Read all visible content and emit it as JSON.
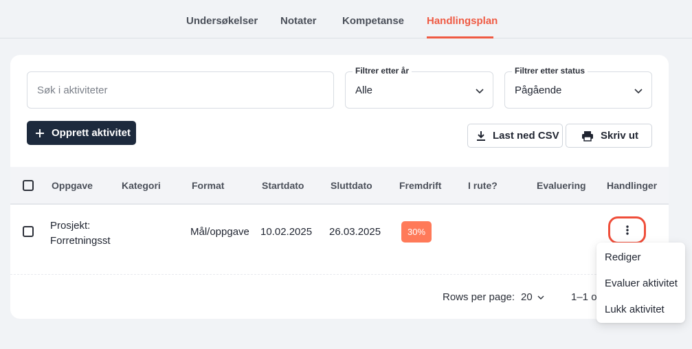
{
  "tabs": [
    {
      "label": "Undersøkelser",
      "active": false
    },
    {
      "label": "Notater",
      "active": false
    },
    {
      "label": "Kompetanse",
      "active": false
    },
    {
      "label": "Handlingsplan",
      "active": true
    }
  ],
  "search": {
    "placeholder": "Søk i aktiviteter",
    "value": ""
  },
  "filters": {
    "year": {
      "label": "Filtrer etter år",
      "value": "Alle"
    },
    "status": {
      "label": "Filtrer etter status",
      "value": "Pågående"
    }
  },
  "buttons": {
    "create": "Opprett aktivitet",
    "download_csv": "Last ned CSV",
    "print": "Skriv ut"
  },
  "table": {
    "columns": [
      "Oppgave",
      "Kategori",
      "Format",
      "Startdato",
      "Sluttdato",
      "Fremdrift",
      "I rute?",
      "Evaluering",
      "Handlinger"
    ],
    "rows": [
      {
        "task_line1": "Prosjekt:",
        "task_line2": "Forretningsst",
        "category": "",
        "format": "Mål/oppgave",
        "start": "10.02.2025",
        "end": "26.03.2025",
        "progress": "30%",
        "on_track": "",
        "evaluation": ""
      }
    ]
  },
  "pagination": {
    "rows_per_page_label": "Rows per page:",
    "rows_per_page": "20",
    "range": "1–1 of"
  },
  "menu": {
    "items": [
      "Rediger",
      "Evaluer aktivitet",
      "Lukk aktivitet"
    ]
  },
  "colors": {
    "accent": "#ef5a43",
    "primary": "#1d2a3d",
    "badge": "#ff7a59"
  }
}
